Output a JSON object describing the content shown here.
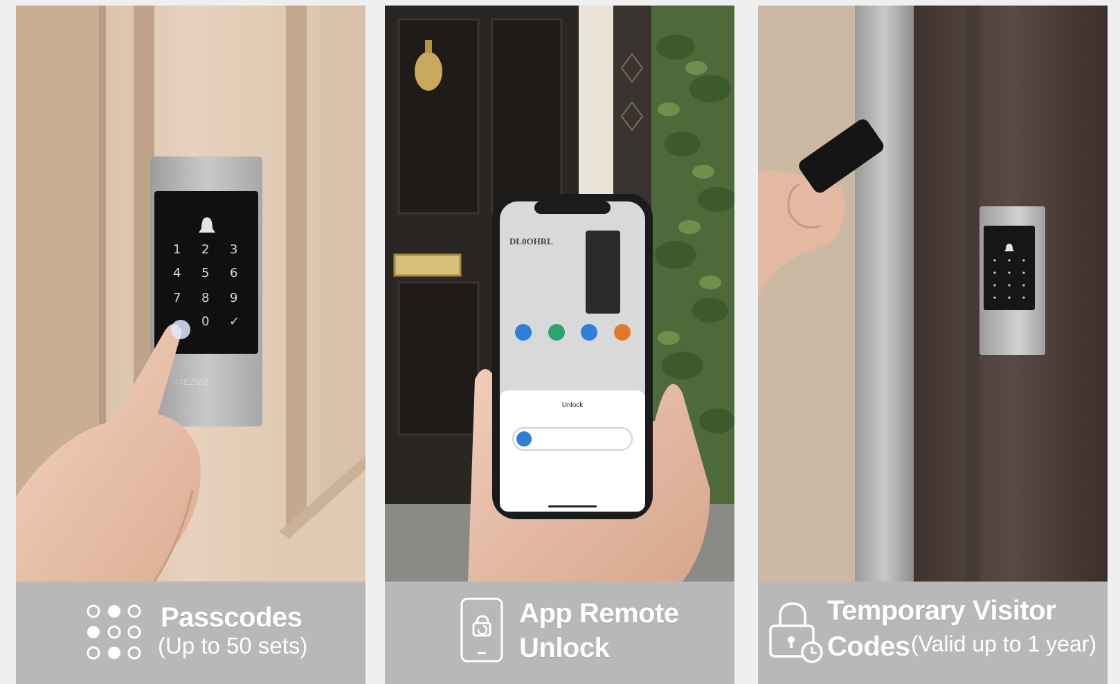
{
  "features": [
    {
      "title": "Passcodes",
      "subtitle": "(Up to 50 sets)",
      "icon": "keypad-dots-icon"
    },
    {
      "title_line1": "App Remote",
      "title_line2": "Unlock",
      "icon": "phone-unlock-icon"
    },
    {
      "title_line1": "Temporary Visitor",
      "title_line2": "Codes",
      "subtitle": "(Valid up to 1 year)",
      "icon": "padlock-clock-icon"
    }
  ],
  "keypad": {
    "keys": [
      "1",
      "2",
      "3",
      "4",
      "5",
      "6",
      "7",
      "8",
      "9",
      "",
      "0",
      "✓"
    ]
  },
  "colors": {
    "caption_bg": "#b8b8b8",
    "caption_text": "#ffffff",
    "lock_screen": "#111111",
    "app_blue": "#2f7fd8"
  }
}
